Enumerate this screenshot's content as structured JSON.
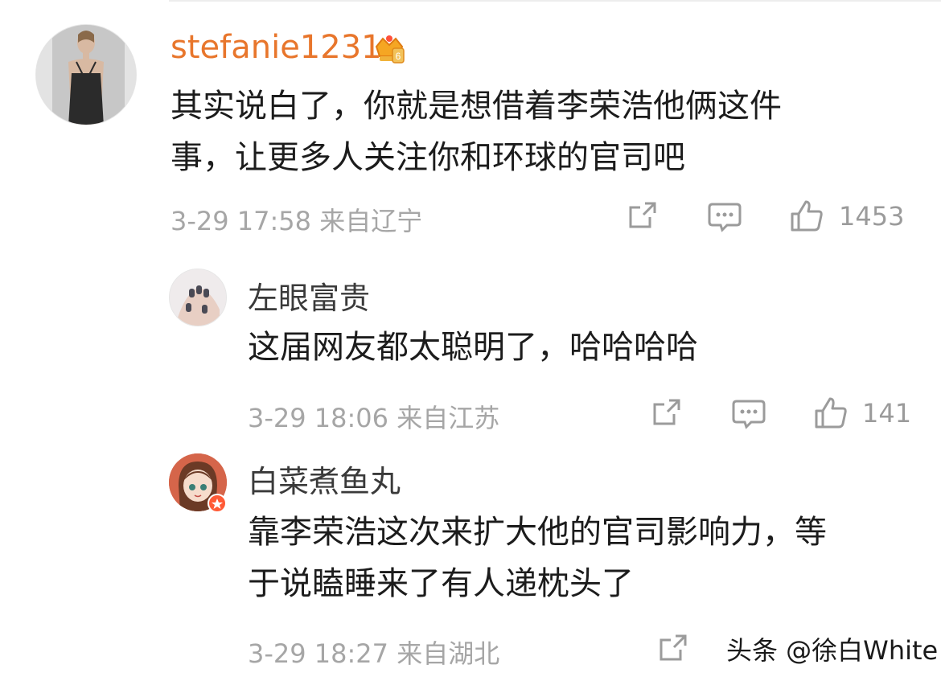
{
  "comments": [
    {
      "username": "stefanie1231",
      "text_lines": [
        "其实说白了，你就是想借着李荣浩他俩这件",
        "事，让更多人关注你和环球的官司吧"
      ],
      "time": "3-29 17:58",
      "location": "来自辽宁",
      "likes": "1453"
    },
    {
      "username": "左眼富贵",
      "text_lines": [
        "这届网友都太聪明了，哈哈哈哈"
      ],
      "time": "3-29 18:06",
      "location": "来自江苏",
      "likes": "141"
    },
    {
      "username": "白菜煮鱼丸",
      "text_lines": [
        "靠李荣浩这次来扩大他的官司影响力，等",
        "于说瞌睡来了有人递枕头了"
      ],
      "time": "3-29 18:27",
      "location": "来自湖北"
    }
  ],
  "icons": {
    "share": "share-icon",
    "comment": "comment-icon",
    "like": "like-icon",
    "crown": "crown-badge-icon"
  },
  "colors": {
    "username_vip": "#e8762c",
    "meta": "#a6a6a6",
    "icon": "#9b9b9b"
  },
  "watermark": "头条 @徐白White"
}
